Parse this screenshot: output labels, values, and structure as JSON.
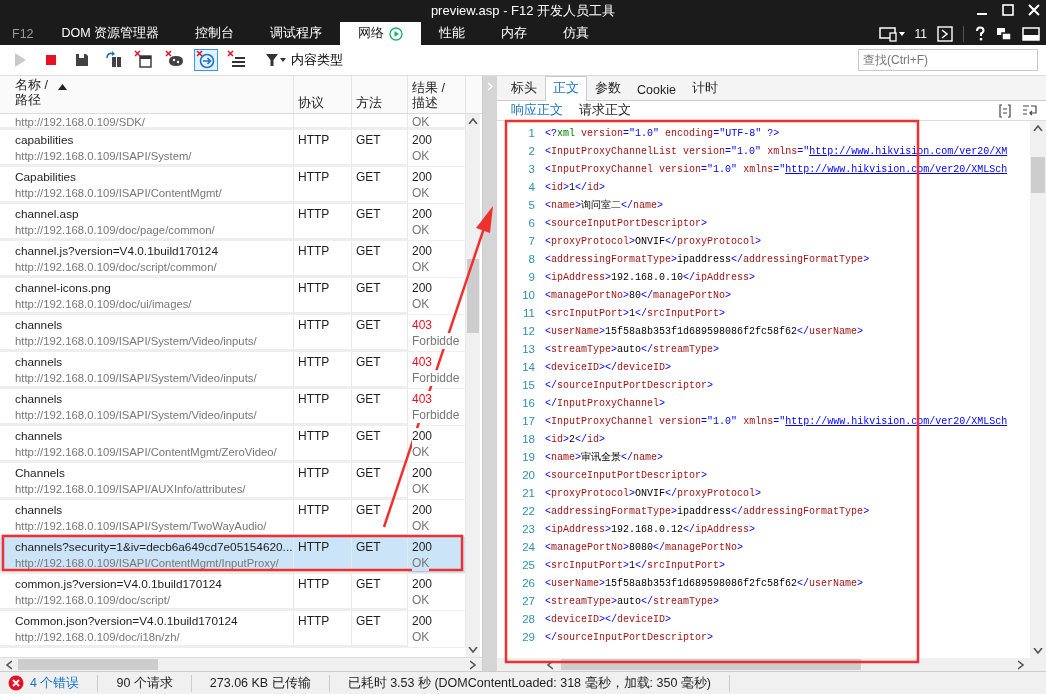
{
  "window": {
    "title": "preview.asp - F12 开发人员工具"
  },
  "tabs": [
    {
      "label": "F12",
      "kind": "logo",
      "selected": false
    },
    {
      "label": "DOM 资源管理器",
      "kind": "tab",
      "selected": false
    },
    {
      "label": "控制台",
      "kind": "tab",
      "selected": false
    },
    {
      "label": "调试程序",
      "kind": "tab",
      "selected": false
    },
    {
      "label": "网络",
      "kind": "tab",
      "selected": true,
      "running": true
    },
    {
      "label": "性能",
      "kind": "tab",
      "selected": false
    },
    {
      "label": "内存",
      "kind": "tab",
      "selected": false
    },
    {
      "label": "仿真",
      "kind": "tab",
      "selected": false
    }
  ],
  "tab_tools": {
    "browser_version": "11"
  },
  "toolbar": {
    "buttons": [
      {
        "kind": "play",
        "disabled": true,
        "selected": false
      },
      {
        "kind": "stop",
        "disabled": false,
        "selected": false
      },
      {
        "kind": "save",
        "disabled": false,
        "selected": false
      },
      {
        "kind": "clear-session",
        "disabled": false,
        "selected": false
      },
      {
        "kind": "clear-window",
        "disabled": false,
        "selected": false
      },
      {
        "kind": "clear-cookie",
        "disabled": false,
        "selected": false
      },
      {
        "kind": "refresh-server",
        "disabled": false,
        "selected": true
      },
      {
        "kind": "clear-list",
        "disabled": false,
        "selected": false
      }
    ],
    "filter_label": "内容类型",
    "search": {
      "placeholder": "查找(Ctrl+F)"
    }
  },
  "requests": {
    "columns": [
      "名称 /\n路径",
      "协议",
      "方法",
      "结果 /\n描述"
    ],
    "top_partial": {
      "path": "http://192.168.0.109/SDK/",
      "description": "OK"
    },
    "rows": [
      {
        "name": "capabilities",
        "path": "http://192.168.0.109/ISAPI/System/",
        "protocol": "HTTP",
        "method": "GET",
        "status": "200",
        "description": "OK",
        "error": false,
        "selected": false
      },
      {
        "name": "Capabilities",
        "path": "http://192.168.0.109/ISAPI/ContentMgmt/",
        "protocol": "HTTP",
        "method": "GET",
        "status": "200",
        "description": "OK",
        "error": false,
        "selected": false
      },
      {
        "name": "channel.asp",
        "path": "http://192.168.0.109/doc/page/common/",
        "protocol": "HTTP",
        "method": "GET",
        "status": "200",
        "description": "OK",
        "error": false,
        "selected": false
      },
      {
        "name": "channel.js?version=V4.0.1build170124",
        "path": "http://192.168.0.109/doc/script/common/",
        "protocol": "HTTP",
        "method": "GET",
        "status": "200",
        "description": "OK",
        "error": false,
        "selected": false
      },
      {
        "name": "channel-icons.png",
        "path": "http://192.168.0.109/doc/ui/images/",
        "protocol": "HTTP",
        "method": "GET",
        "status": "200",
        "description": "OK",
        "error": false,
        "selected": false
      },
      {
        "name": "channels",
        "path": "http://192.168.0.109/ISAPI/System/Video/inputs/",
        "protocol": "HTTP",
        "method": "GET",
        "status": "403",
        "description": "Forbidde",
        "error": true,
        "selected": false
      },
      {
        "name": "channels",
        "path": "http://192.168.0.109/ISAPI/System/Video/inputs/",
        "protocol": "HTTP",
        "method": "GET",
        "status": "403",
        "description": "Forbidde",
        "error": true,
        "selected": false
      },
      {
        "name": "channels",
        "path": "http://192.168.0.109/ISAPI/System/Video/inputs/",
        "protocol": "HTTP",
        "method": "GET",
        "status": "403",
        "description": "Forbidde",
        "error": true,
        "selected": false
      },
      {
        "name": "channels",
        "path": "http://192.168.0.109/ISAPI/ContentMgmt/ZeroVideo/",
        "protocol": "HTTP",
        "method": "GET",
        "status": "200",
        "description": "OK",
        "error": false,
        "selected": false
      },
      {
        "name": "Channels",
        "path": "http://192.168.0.109/ISAPI/AUXInfo/attributes/",
        "protocol": "HTTP",
        "method": "GET",
        "status": "200",
        "description": "OK",
        "error": false,
        "selected": false
      },
      {
        "name": "channels",
        "path": "http://192.168.0.109/ISAPI/System/TwoWayAudio/",
        "protocol": "HTTP",
        "method": "GET",
        "status": "200",
        "description": "OK",
        "error": false,
        "selected": false
      },
      {
        "name": "channels?security=1&iv=decb6a649cd7e05154620...",
        "path": "http://192.168.0.109/ISAPI/ContentMgmt/InputProxy/",
        "protocol": "HTTP",
        "method": "GET",
        "status": "200",
        "description": "OK",
        "error": false,
        "selected": true
      },
      {
        "name": "common.js?version=V4.0.1build170124",
        "path": "http://192.168.0.109/doc/script/",
        "protocol": "HTTP",
        "method": "GET",
        "status": "200",
        "description": "OK",
        "error": false,
        "selected": false
      },
      {
        "name": "Common.json?version=V4.0.1build170124",
        "path": "http://192.168.0.109/doc/i18n/zh/",
        "protocol": "HTTP",
        "method": "GET",
        "status": "200",
        "description": "OK",
        "error": false,
        "selected": false
      }
    ]
  },
  "detail_tabs": [
    {
      "label": "标头",
      "selected": false
    },
    {
      "label": "正文",
      "selected": true
    },
    {
      "label": "参数",
      "selected": false
    },
    {
      "label": "Cookie",
      "selected": false
    },
    {
      "label": "计时",
      "selected": false
    }
  ],
  "body_tabs": [
    {
      "label": "响应正文",
      "selected": true
    },
    {
      "label": "请求正文",
      "selected": false
    }
  ],
  "code_lines": [
    {
      "number": "1",
      "text": "<?xml version=\"1.0\" encoding=\"UTF-8\" ?>"
    },
    {
      "number": "2",
      "text": "<InputProxyChannelList version=\"1.0\" xmlns=\"http://www.hikvision.com/ver20/XM"
    },
    {
      "number": "3",
      "text": "<InputProxyChannel version=\"1.0\" xmlns=\"http://www.hikvision.com/ver20/XMLSch"
    },
    {
      "number": "4",
      "text": "<id>1</id>"
    },
    {
      "number": "5",
      "text": "<name>询问室二</name>"
    },
    {
      "number": "6",
      "text": "<sourceInputPortDescriptor>"
    },
    {
      "number": "7",
      "text": "<proxyProtocol>ONVIF</proxyProtocol>"
    },
    {
      "number": "8",
      "text": "<addressingFormatType>ipaddress</addressingFormatType>"
    },
    {
      "number": "9",
      "text": "<ipAddress>192.168.0.10</ipAddress>"
    },
    {
      "number": "10",
      "text": "<managePortNo>80</managePortNo>"
    },
    {
      "number": "11",
      "text": "<srcInputPort>1</srcInputPort>"
    },
    {
      "number": "12",
      "text": "<userName>15f58a8b353f1d689598086f2fc58f62</userName>"
    },
    {
      "number": "13",
      "text": "<streamType>auto</streamType>"
    },
    {
      "number": "14",
      "text": "<deviceID></deviceID>"
    },
    {
      "number": "15",
      "text": "</sourceInputPortDescriptor>"
    },
    {
      "number": "16",
      "text": "</InputProxyChannel>"
    },
    {
      "number": "17",
      "text": "<InputProxyChannel version=\"1.0\" xmlns=\"http://www.hikvision.com/ver20/XMLSch"
    },
    {
      "number": "18",
      "text": "<id>2</id>"
    },
    {
      "number": "19",
      "text": "<name>审讯全景</name>"
    },
    {
      "number": "20",
      "text": "<sourceInputPortDescriptor>"
    },
    {
      "number": "21",
      "text": "<proxyProtocol>ONVIF</proxyProtocol>"
    },
    {
      "number": "22",
      "text": "<addressingFormatType>ipaddress</addressingFormatType>"
    },
    {
      "number": "23",
      "text": "<ipAddress>192.168.0.12</ipAddress>"
    },
    {
      "number": "24",
      "text": "<managePortNo>8080</managePortNo>"
    },
    {
      "number": "25",
      "text": "<srcInputPort>1</srcInputPort>"
    },
    {
      "number": "26",
      "text": "<userName>15f58a8b353f1d689598086f2fc58f62</userName>"
    },
    {
      "number": "27",
      "text": "<streamType>auto</streamType>"
    },
    {
      "number": "28",
      "text": "<deviceID></deviceID>"
    },
    {
      "number": "29",
      "text": "</sourceInputPortDescriptor>"
    }
  ],
  "status_bar": {
    "errors": "4 个错误",
    "requests": "90 个请求",
    "transferred": "273.06 KB 已传输",
    "elapsed": "已耗时 3.53 秒 (DOMContentLoaded: 318 毫秒，加载: 350 毫秒)"
  },
  "annotations": [
    {
      "kind": "box"
    },
    {
      "kind": "box"
    },
    {
      "kind": "arrow"
    }
  ]
}
